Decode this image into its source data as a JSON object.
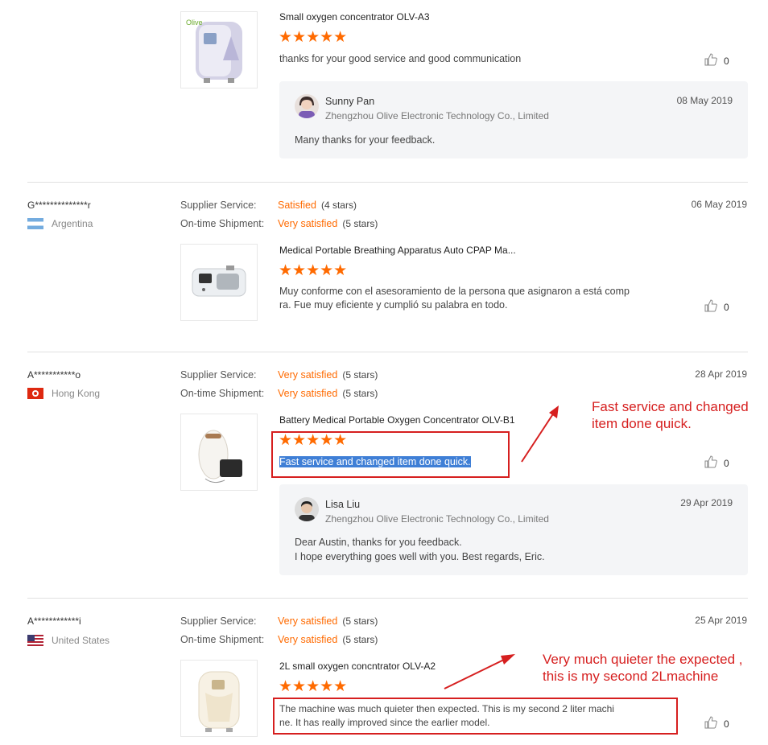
{
  "colors": {
    "accent": "#ff6a00",
    "annotation": "#d61f1f",
    "highlight": "#3f7fd6"
  },
  "reviews": [
    {
      "product": "Small oxygen concentrator OLV-A3",
      "brand_mark": "Olive",
      "rating": 5,
      "text": "thanks for your good service and good communication",
      "likes": "0",
      "reply": {
        "name": "Sunny Pan",
        "company": "Zhengzhou Olive Electronic Technology Co., Limited",
        "date": "08 May 2019",
        "body": [
          "Many thanks for your feedback."
        ]
      }
    },
    {
      "buyer": "G**************r",
      "country": "Argentina",
      "supplier_label": "Supplier Service:",
      "supplier_value": "Satisfied",
      "supplier_stars": "(4 stars)",
      "shipment_label": "On-time Shipment:",
      "shipment_value": "Very satisfied",
      "shipment_stars": "(5 stars)",
      "date": "06 May 2019",
      "product": "Medical Portable Breathing Apparatus Auto CPAP Ma...",
      "rating": 5,
      "text_lines": [
        "Muy conforme con el asesoramiento de la persona que asignaron a está comp",
        "ra. Fue muy eficiente y cumplió su palabra en todo."
      ],
      "likes": "0"
    },
    {
      "buyer": "A***********o",
      "country": "Hong Kong",
      "supplier_label": "Supplier Service:",
      "supplier_value": "Very satisfied",
      "supplier_stars": "(5 stars)",
      "shipment_label": "On-time Shipment:",
      "shipment_value": "Very satisfied",
      "shipment_stars": "(5 stars)",
      "date": "28 Apr 2019",
      "product": "Battery Medical Portable Oxygen Concentrator OLV-B1",
      "rating": 5,
      "text": "Fast service and changed item done quick.",
      "likes": "0",
      "annotation": [
        "Fast service and changed",
        "item done quick."
      ],
      "reply": {
        "name": "Lisa Liu",
        "company": "Zhengzhou Olive Electronic Technology Co., Limited",
        "date": "29 Apr 2019",
        "body": [
          "Dear Austin, thanks for you feedback.",
          "I hope everything goes well with you. Best regards, Eric."
        ]
      }
    },
    {
      "buyer": "A************i",
      "country": "United States",
      "supplier_label": "Supplier Service:",
      "supplier_value": "Very satisfied",
      "supplier_stars": "(5 stars)",
      "shipment_label": "On-time Shipment:",
      "shipment_value": "Very satisfied",
      "shipment_stars": "(5 stars)",
      "date": "25 Apr 2019",
      "product": "2L small oxygen concntrator OLV-A2",
      "rating": 5,
      "text_lines": [
        "The machine was much quieter then expected. This is my second 2 liter machi",
        "ne. It has really improved since the  earlier model."
      ],
      "likes": "0",
      "annotation": [
        "Very much quieter the expected ,",
        "this is my second 2Lmachine"
      ]
    }
  ]
}
